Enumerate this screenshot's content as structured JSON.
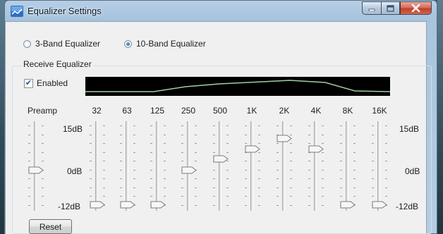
{
  "window": {
    "title": "Equalizer Settings",
    "icon": "equalizer-app-icon",
    "caption_buttons": [
      "minimize-icon",
      "maximize-icon",
      "close-icon"
    ]
  },
  "mode": {
    "options": [
      {
        "label": "3-Band Equalizer",
        "selected": false
      },
      {
        "label": "10-Band Equalizer",
        "selected": true
      }
    ]
  },
  "receive": {
    "group_label": "Receive Equalizer",
    "enabled_label": "Enabled",
    "enabled_checked": true
  },
  "sliders": {
    "scale": {
      "max_label": "15dB",
      "mid_label": "0dB",
      "min_label": "-12dB",
      "max": 15,
      "min": -12
    },
    "preamp": {
      "label": "Preamp",
      "level": 0
    },
    "bands": [
      {
        "label": "32",
        "level": -12
      },
      {
        "label": "63",
        "level": -12
      },
      {
        "label": "125",
        "level": -12
      },
      {
        "label": "250",
        "level": 0
      },
      {
        "label": "500",
        "level": 4
      },
      {
        "label": "1K",
        "level": 7.5
      },
      {
        "label": "2K",
        "level": 11
      },
      {
        "label": "4K",
        "level": 7.5
      },
      {
        "label": "8K",
        "level": -12
      },
      {
        "label": "16K",
        "level": -12
      }
    ]
  },
  "actions": {
    "reset_label": "Reset"
  },
  "colors": {
    "curve": "#9ecfa0",
    "display_bg": "#000000",
    "window_frame": "#a9c4de"
  }
}
